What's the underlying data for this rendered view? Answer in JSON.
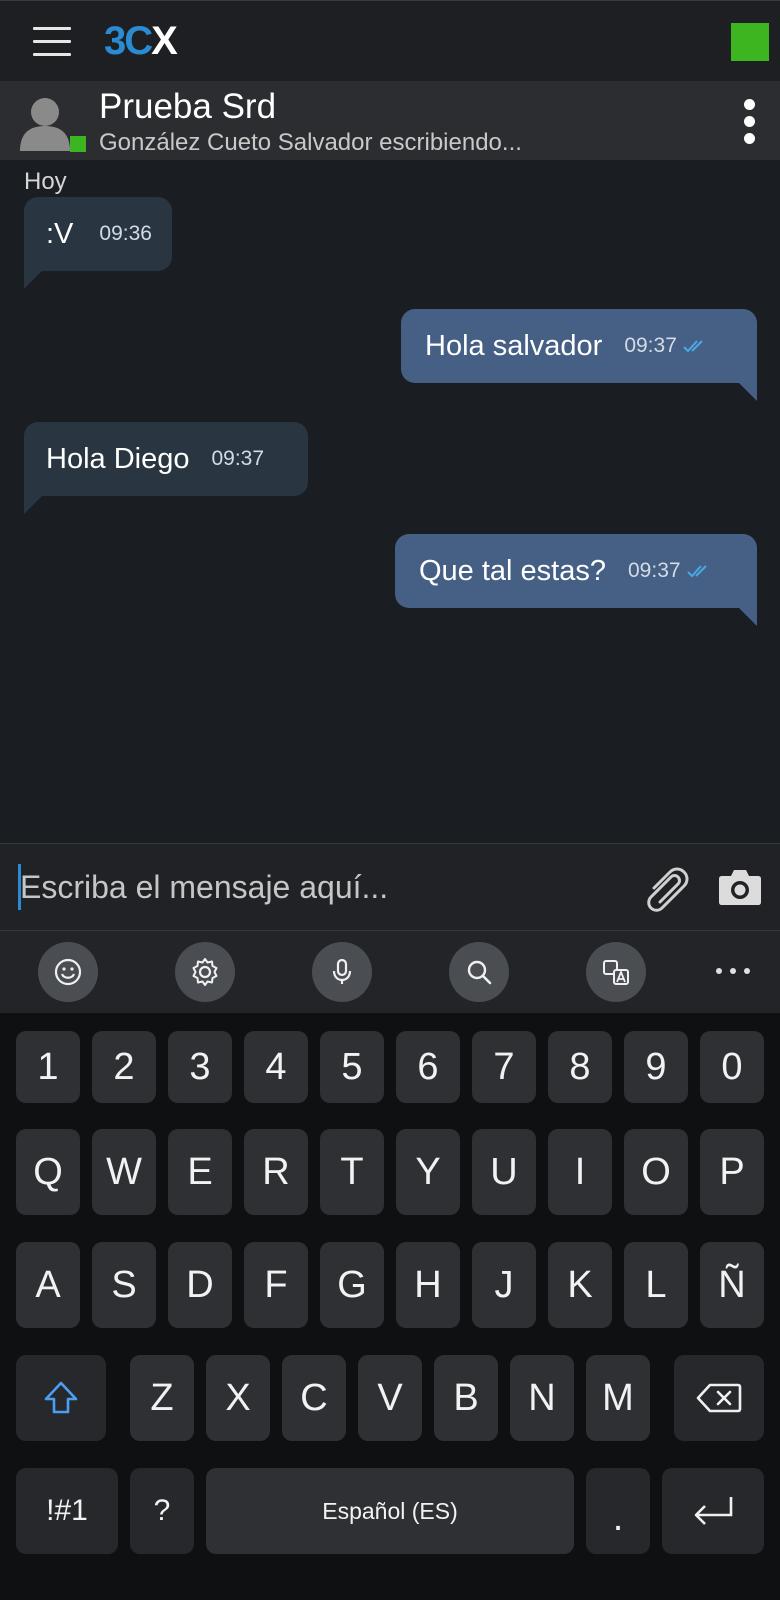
{
  "app": {
    "logo_parts": [
      "3",
      "C",
      "X"
    ],
    "status_color": "#3cb521",
    "accent_color": "#2a8ad2"
  },
  "chat": {
    "name": "Prueba Srd",
    "status": "González Cueto Salvador escribiendo..."
  },
  "messages": {
    "day_label": "Hoy",
    "items": [
      {
        "direction": "in",
        "text": ":V",
        "time": "09:36"
      },
      {
        "direction": "out",
        "text": "Hola salvador",
        "time": "09:37"
      },
      {
        "direction": "in",
        "text": "Hola Diego",
        "time": "09:37"
      },
      {
        "direction": "out",
        "text": "Que tal estas?",
        "time": "09:37"
      }
    ]
  },
  "composer": {
    "placeholder": "Escriba el mensaje aquí..."
  },
  "keyboard_tools": [
    "emoji-icon",
    "settings-icon",
    "microphone-icon",
    "search-icon",
    "translate-icon",
    "more-icon"
  ],
  "keyboard": {
    "row_numbers": [
      "1",
      "2",
      "3",
      "4",
      "5",
      "6",
      "7",
      "8",
      "9",
      "0"
    ],
    "row_top": [
      "Q",
      "W",
      "E",
      "R",
      "T",
      "Y",
      "U",
      "I",
      "O",
      "P"
    ],
    "row_mid": [
      "A",
      "S",
      "D",
      "F",
      "G",
      "H",
      "J",
      "K",
      "L",
      "Ñ"
    ],
    "row_bottom": [
      "Z",
      "X",
      "C",
      "V",
      "B",
      "N",
      "M"
    ],
    "symbols_label": "!#1",
    "question_label": "?",
    "space_label": "Español (ES)",
    "period_label": "."
  }
}
